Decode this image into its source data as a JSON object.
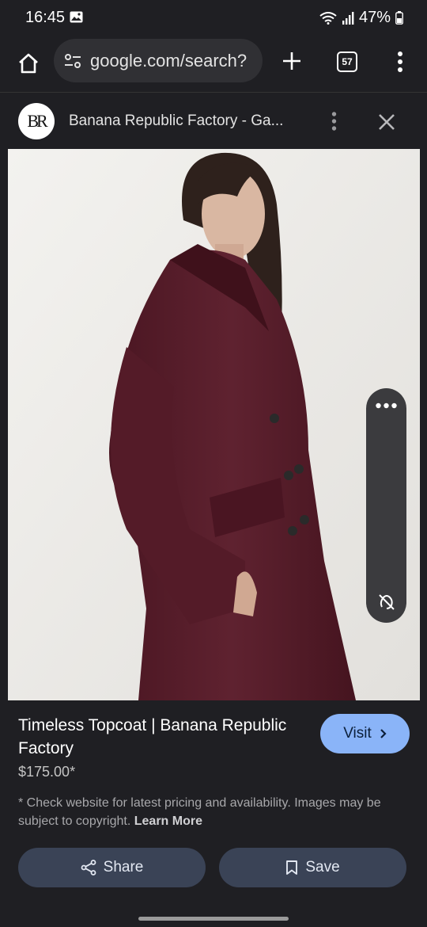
{
  "status_bar": {
    "time": "16:45",
    "battery": "47%"
  },
  "browser": {
    "url": "google.com/search?",
    "tab_count": "57"
  },
  "sheet": {
    "logo_text": "BR",
    "site_title": "Banana Republic Factory - Ga..."
  },
  "product": {
    "title": "Timeless Topcoat | Banana Republic Factory",
    "price": "$175.00*",
    "visit_label": "Visit",
    "disclaimer": "* Check website for latest pricing and availability. Images may be subject to copyright.",
    "learn_more": "Learn More"
  },
  "actions": {
    "share_label": "Share",
    "save_label": "Save"
  },
  "colors": {
    "accent": "#8ab4f8",
    "coat": "#5a1e2c",
    "panel": "#1f1f23"
  },
  "icons": [
    "gallery-icon",
    "wifi-icon",
    "signal-icon",
    "battery-icon",
    "home-icon",
    "tune-icon",
    "plus-icon",
    "more-vert-icon",
    "close-icon",
    "more-horiz-icon",
    "hide-icon",
    "lens-icon",
    "chevron-right-icon",
    "share-icon",
    "bookmark-icon"
  ]
}
